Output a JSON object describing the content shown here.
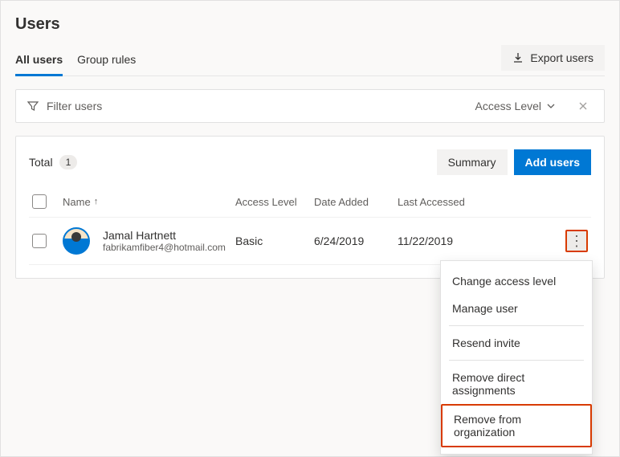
{
  "header": {
    "title": "Users"
  },
  "tabs": {
    "all": "All users",
    "groups": "Group rules"
  },
  "export_label": "Export users",
  "filter": {
    "placeholder": "Filter users",
    "access_level": "Access Level"
  },
  "summary": {
    "total_label": "Total",
    "total_count": "1",
    "summary_btn": "Summary",
    "add_btn": "Add users"
  },
  "columns": {
    "name": "Name",
    "access": "Access Level",
    "added": "Date Added",
    "last": "Last Accessed"
  },
  "row": {
    "name": "Jamal Hartnett",
    "email": "fabrikamfiber4@hotmail.com",
    "access": "Basic",
    "added": "6/24/2019",
    "last": "11/22/2019"
  },
  "menu": {
    "change": "Change access level",
    "manage": "Manage user",
    "resend": "Resend invite",
    "remove_direct": "Remove direct assignments",
    "remove_org": "Remove from organization"
  }
}
